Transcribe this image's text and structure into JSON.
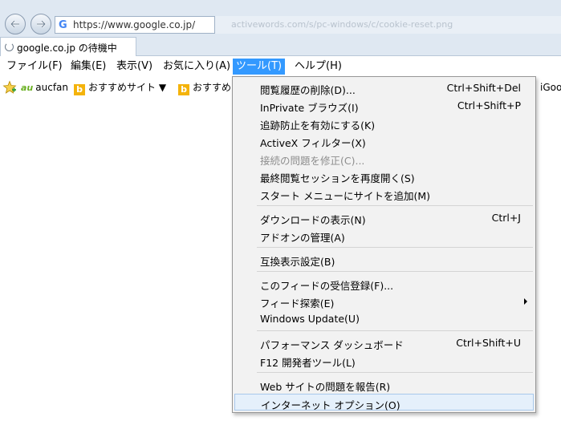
{
  "address": {
    "url": "https://www.google.co.jp/",
    "ghost_text": "activewords.com/s/pc-windows/c/cookie-reset.png"
  },
  "tab": {
    "title": "google.co.jp の待機中"
  },
  "menubar": [
    {
      "label": "ファイル(F)"
    },
    {
      "label": "編集(E)"
    },
    {
      "label": "表示(V)"
    },
    {
      "label": "お気に入り(A)"
    },
    {
      "label": "ツール(T)"
    },
    {
      "label": "ヘルプ(H)"
    }
  ],
  "favorites": [
    {
      "label": "aucfan"
    },
    {
      "label": "おすすめサイト ▼"
    },
    {
      "label": "おすすめ"
    },
    {
      "label": "iGoo"
    }
  ],
  "tools_menu": [
    {
      "label": "閲覧履歴の削除(D)...",
      "shortcut": "Ctrl+Shift+Del"
    },
    {
      "label": "InPrivate ブラウズ(I)",
      "shortcut": "Ctrl+Shift+P"
    },
    {
      "label": "追跡防止を有効にする(K)",
      "shortcut": ""
    },
    {
      "label": "ActiveX フィルター(X)",
      "shortcut": ""
    },
    {
      "label": "接続の問題を修正(C)...",
      "shortcut": ""
    },
    {
      "label": "最終閲覧セッションを再度開く(S)",
      "shortcut": ""
    },
    {
      "label": "スタート メニューにサイトを追加(M)",
      "shortcut": ""
    },
    {
      "label": "ダウンロードの表示(N)",
      "shortcut": "Ctrl+J"
    },
    {
      "label": "アドオンの管理(A)",
      "shortcut": ""
    },
    {
      "label": "互換表示設定(B)",
      "shortcut": ""
    },
    {
      "label": "このフィードの受信登録(F)...",
      "shortcut": ""
    },
    {
      "label": "フィード探索(E)",
      "shortcut": ""
    },
    {
      "label": "Windows Update(U)",
      "shortcut": ""
    },
    {
      "label": "パフォーマンス ダッシュボード",
      "shortcut": "Ctrl+Shift+U"
    },
    {
      "label": "F12 開発者ツール(L)",
      "shortcut": ""
    },
    {
      "label": "Web サイトの問題を報告(R)",
      "shortcut": ""
    },
    {
      "label": "インターネット オプション(O)",
      "shortcut": ""
    }
  ]
}
